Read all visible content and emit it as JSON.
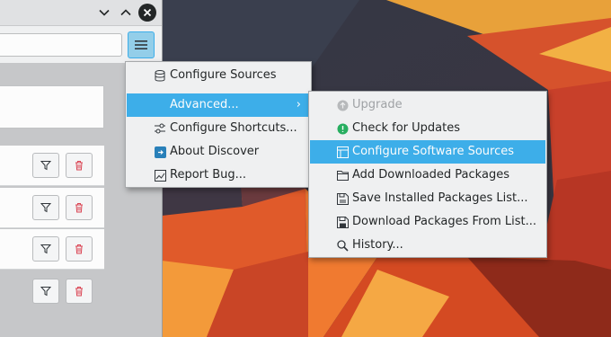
{
  "window": {
    "titlebar_buttons": [
      "minimize",
      "maximize",
      "close"
    ],
    "search": {
      "value": "",
      "placeholder": ""
    },
    "menu_button_icon": "hamburger-menu-icon"
  },
  "main_menu": {
    "items": [
      {
        "label": "Configure Sources",
        "icon": "database-icon"
      },
      {
        "label": "Advanced...",
        "icon": "",
        "submenu": true,
        "highlighted": true
      },
      {
        "label": "Configure Shortcuts...",
        "icon": "shortcuts-icon"
      },
      {
        "label": "About Discover",
        "icon": "discover-app-icon"
      },
      {
        "label": "Report Bug...",
        "icon": "bug-report-icon"
      }
    ],
    "submenu_arrow": "›"
  },
  "advanced_menu": {
    "items": [
      {
        "label": "Upgrade",
        "icon": "upgrade-icon",
        "disabled": true
      },
      {
        "label": "Check for Updates",
        "icon": "check-updates-icon"
      },
      {
        "label": "Configure Software Sources",
        "icon": "software-sources-icon",
        "highlighted": true
      },
      {
        "label": "Add Downloaded Packages",
        "icon": "folder-icon"
      },
      {
        "label": "Save Installed Packages List...",
        "icon": "save-list-icon"
      },
      {
        "label": "Download Packages From List...",
        "icon": "save-icon"
      },
      {
        "label": "History...",
        "icon": "search-icon"
      }
    ]
  },
  "rows": {
    "buttons": [
      "filter-button",
      "remove-button"
    ]
  },
  "colors": {
    "highlight": "#3daee9",
    "remove_icon": "#da4453",
    "update_icon": "#27ae60"
  }
}
